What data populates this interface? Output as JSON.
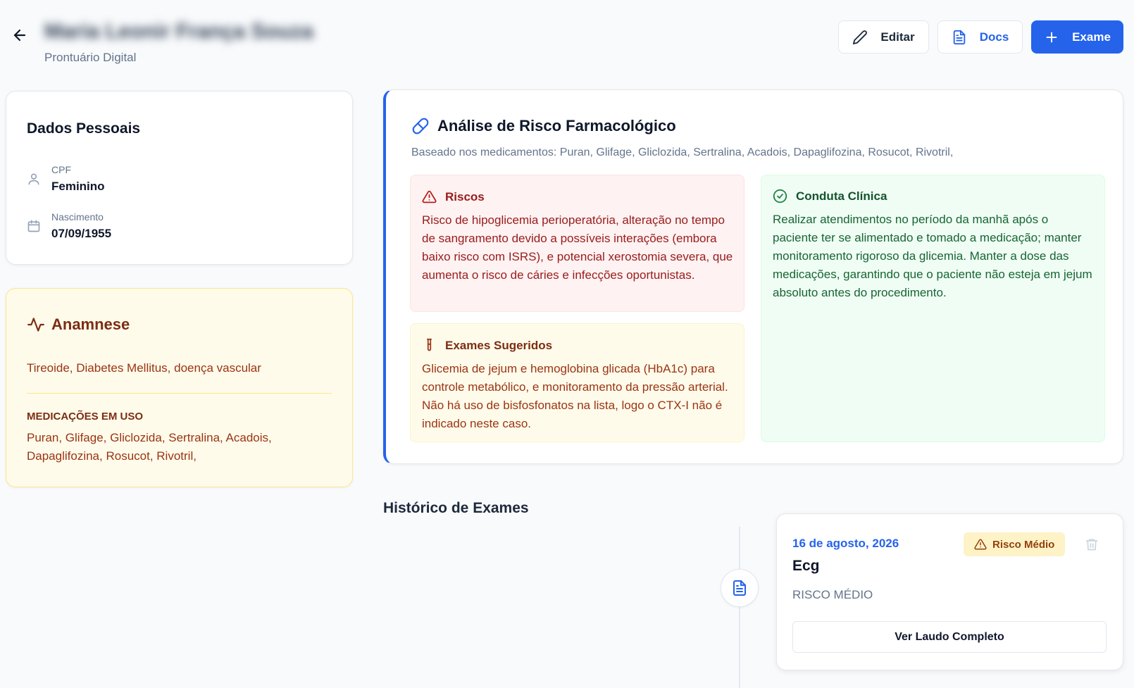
{
  "header": {
    "patient_name": "Maria Leonir França Souza",
    "subtitle": "Prontuário Digital",
    "edit_label": "Editar",
    "docs_label": "Docs",
    "exam_label": "Exame"
  },
  "personal": {
    "title": "Dados Pessoais",
    "cpf_label": "CPF",
    "cpf_value": "Feminino",
    "birth_label": "Nascimento",
    "birth_value": "07/09/1955"
  },
  "anamnese": {
    "title": "Anamnese",
    "conditions": "Tireoide, Diabetes Mellitus, doença vascular",
    "meds_label": "MEDICAÇÕES EM USO",
    "meds": "Puran, Glifage, Gliclozida, Sertralina, Acadois, Dapaglifozina, Rosucot, Rivotril,"
  },
  "risk_analysis": {
    "title": "Análise de Risco Farmacológico",
    "subtitle": "Baseado nos medicamentos: Puran, Glifage, Gliclozida, Sertralina, Acadois, Dapaglifozina, Rosucot, Rivotril,",
    "risks_title": "Riscos",
    "risks_text": "Risco de hipoglicemia perioperatória, alteração no tempo de sangramento devido a possíveis interações (embora baixo risco com ISRS), e potencial xerostomia severa, que aumenta o risco de cáries e infecções oportunistas.",
    "exams_title": "Exames Sugeridos",
    "exams_text": "Glicemia de jejum e hemoglobina glicada (HbA1c) para controle metabólico, e monitoramento da pressão arterial. Não há uso de bisfosfonatos na lista, logo o CTX-I não é indicado neste caso.",
    "conduct_title": "Conduta Clínica",
    "conduct_text": "Realizar atendimentos no período da manhã após o paciente ter se alimentado e tomado a medicação; manter monitoramento rigoroso da glicemia. Manter a dose das medicações, garantindo que o paciente não esteja em jejum absoluto antes do procedimento."
  },
  "history": {
    "title": "Histórico de Exames",
    "items": [
      {
        "date": "16 de agosto, 2026",
        "name": "Ecg",
        "badge": "Risco Médio",
        "risk_text": "RISCO MÉDIO",
        "button_label": "Ver Laudo Completo"
      }
    ]
  },
  "colors": {
    "primary": "#2563eb",
    "risk_bg": "#fef2f2",
    "exams_bg": "#fffbeb",
    "conduct_bg": "#f0fdf4",
    "badge_bg": "#fef3c7"
  }
}
